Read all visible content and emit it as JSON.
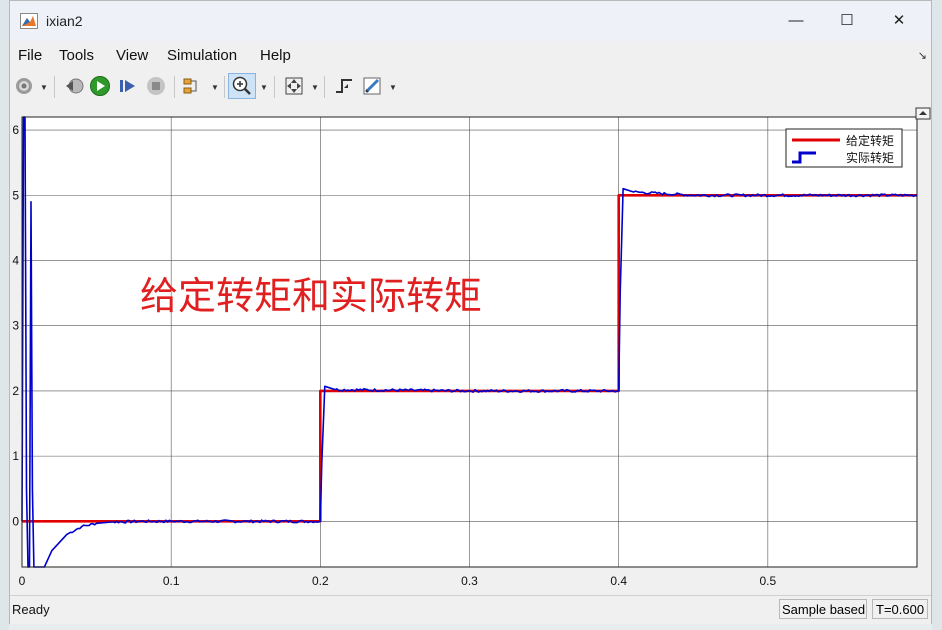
{
  "window": {
    "title": "ixian2",
    "controls": {
      "minimize": "—",
      "maximize": "☐",
      "close": "✕"
    }
  },
  "menu": [
    "File",
    "Tools",
    "View",
    "Simulation",
    "Help"
  ],
  "toolbar": {
    "icons": [
      "gear-icon",
      "step-back-icon",
      "run-icon",
      "step-forward-icon",
      "stop-icon",
      "highlight-icon",
      "zoom-icon",
      "autoscale-icon",
      "triggers-icon",
      "style-icon"
    ]
  },
  "plot": {
    "annotation": "给定转矩和实际转矩",
    "legend": [
      {
        "label": "给定转矩",
        "color": "#e00000"
      },
      {
        "label": "实际转矩",
        "color": "#0000cc"
      }
    ]
  },
  "chart_data": {
    "type": "line",
    "title": "",
    "xlabel": "",
    "ylabel": "",
    "xlim": [
      0,
      0.6
    ],
    "ylim": [
      -0.7,
      6.2
    ],
    "xticks": [
      "0",
      "0.1",
      "0.2",
      "0.3",
      "0.4",
      "0.5"
    ],
    "yticks": [
      "0",
      "1",
      "2",
      "3",
      "4",
      "5",
      "6"
    ],
    "grid": true,
    "legend_position": "top-right",
    "series": [
      {
        "name": "给定转矩",
        "color": "#e00000",
        "x": [
          0,
          0.2,
          0.2,
          0.4,
          0.4,
          0.6
        ],
        "y": [
          0,
          0,
          2,
          2,
          5,
          5
        ]
      },
      {
        "name": "实际转矩",
        "color": "#0000cc",
        "x": [
          0,
          0.001,
          0.002,
          0.003,
          0.004,
          0.005,
          0.006,
          0.007,
          0.008,
          0.009,
          0.01,
          0.012,
          0.015,
          0.02,
          0.03,
          0.04,
          0.05,
          0.06,
          0.08,
          0.1,
          0.15,
          0.2,
          0.201,
          0.203,
          0.21,
          0.3,
          0.4,
          0.401,
          0.403,
          0.41,
          0.45,
          0.6
        ],
        "y": [
          0,
          6.2,
          6.2,
          0.5,
          -0.7,
          -0.7,
          4.9,
          0.5,
          -0.7,
          -0.7,
          -0.7,
          -0.7,
          -0.7,
          -0.45,
          -0.2,
          -0.08,
          -0.03,
          -0.01,
          0,
          0,
          0,
          0,
          0.9,
          2.07,
          2.02,
          2.0,
          2.0,
          3.5,
          5.1,
          5.05,
          5.0,
          5.0
        ]
      }
    ]
  },
  "status": {
    "ready": "Ready",
    "sample": "Sample based",
    "time": "T=0.600"
  }
}
